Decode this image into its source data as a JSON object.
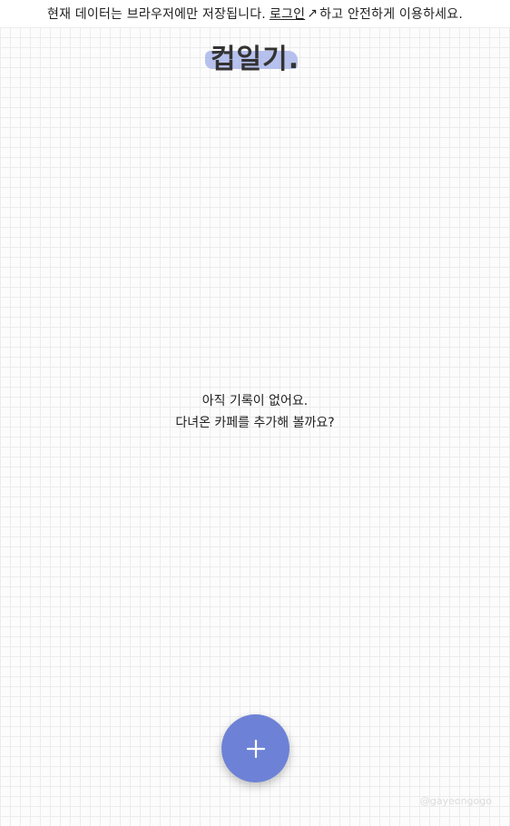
{
  "notice": {
    "prefix": "현재 데이터는 브라우저에만 저장됩니다.",
    "login_label": "로그인",
    "arrow": "↗",
    "suffix": "하고 안전하게 이용하세요."
  },
  "header": {
    "title": "컵일기."
  },
  "empty_state": {
    "line1": "아직 기록이 없어요.",
    "line2": "다녀온 카페를 추가해 볼까요?"
  },
  "fab": {
    "icon": "plus-icon",
    "color": "#6d82d6"
  },
  "watermark": {
    "text": "@gayeongogo"
  },
  "colors": {
    "accent": "#6d82d6",
    "highlight": "#aab6ea"
  }
}
